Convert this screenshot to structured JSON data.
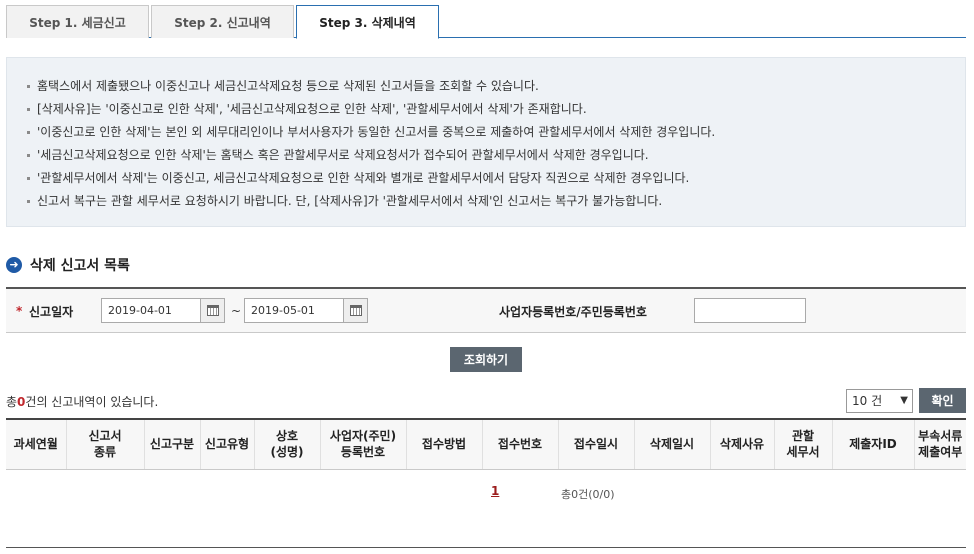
{
  "tabs": [
    {
      "label": "Step 1. 세금신고"
    },
    {
      "label": "Step 2. 신고내역"
    },
    {
      "label": "Step 3. 삭제내역"
    }
  ],
  "info_items": [
    "홈택스에서 제출됐으나 이중신고나 세금신고삭제요청 등으로 삭제된 신고서들을 조회할 수 있습니다.",
    "[삭제사유]는 '이중신고로 인한 삭제', '세금신고삭제요청으로 인한 삭제', '관할세무서에서 삭제'가 존재합니다.",
    "'이중신고로 인한 삭제'는 본인 외 세무대리인이나 부서사용자가 동일한 신고서를 중복으로 제출하여 관할세무서에서 삭제한 경우입니다.",
    "'세금신고삭제요청으로 인한 삭제'는 홈택스 혹은 관할세무서로 삭제요청서가 접수되어 관할세무서에서 삭제한 경우입니다.",
    "'관할세무서에서 삭제'는 이중신고, 세금신고삭제요청으로 인한 삭제와 별개로 관할세무서에서 담당자 직권으로 삭제한 경우입니다.",
    "신고서 복구는 관할 세무서로 요청하시기 바랍니다. 단, [삭제사유]가 '관할세무서에서 삭제'인 신고서는 복구가 불가능합니다."
  ],
  "section": {
    "title": "삭제 신고서 목록"
  },
  "search": {
    "required_mark": "*",
    "date_label": "신고일자",
    "date_from": "2019-04-01",
    "date_to": "2019-05-01",
    "tilde": "~",
    "biz_label": "사업자등록번호/주민등록번호",
    "biz_value": ""
  },
  "query_button": "조회하기",
  "result": {
    "prefix": "총",
    "count": "0",
    "suffix": "건의 신고내역이 있습니다."
  },
  "page_size": {
    "selected": "10 건",
    "arrow": "▼"
  },
  "confirm_button": "확인",
  "table_headers": [
    [
      "과세연월"
    ],
    [
      "신고서",
      "종류"
    ],
    [
      "신고구분"
    ],
    [
      "신고유형"
    ],
    [
      "상호",
      "(성명)"
    ],
    [
      "사업자(주민)",
      "등록번호"
    ],
    [
      "접수방법"
    ],
    [
      "접수번호"
    ],
    [
      "접수일시"
    ],
    [
      "삭제일시"
    ],
    [
      "삭제사유"
    ],
    [
      "관할",
      "세무서"
    ],
    [
      "제출자ID"
    ],
    [
      "부속서류",
      "제출여부"
    ]
  ],
  "pager": {
    "page": "1",
    "summary": "총0건(0/0)"
  }
}
